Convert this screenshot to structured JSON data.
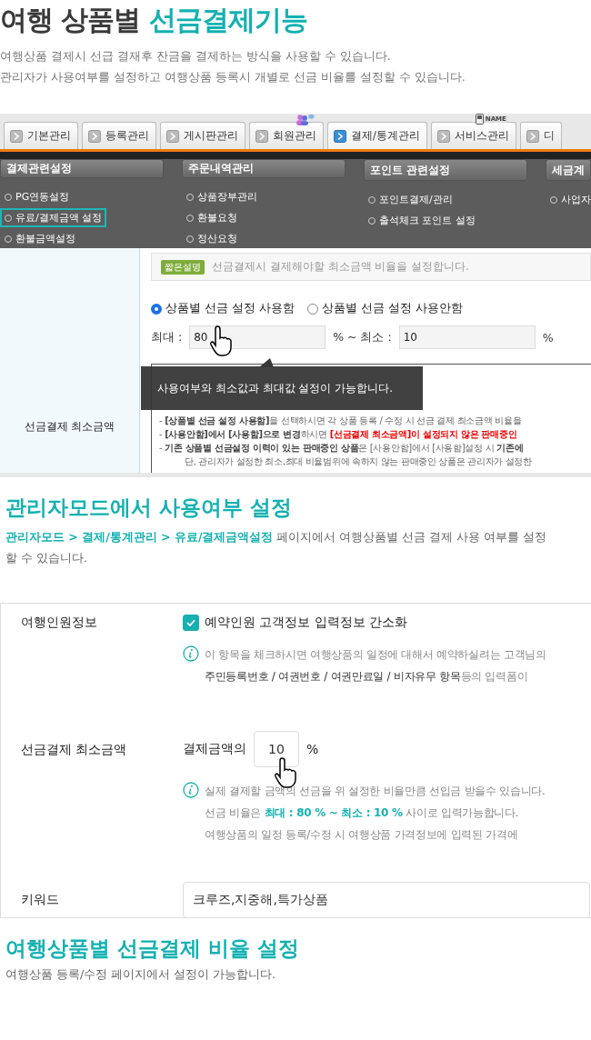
{
  "heading": [
    {
      "text": "여행 상품별 ",
      "kind": "normal"
    },
    {
      "text": "선금결제기능",
      "kind": "highlight"
    }
  ],
  "intro": [
    "여행상품 결제시 선급 결재후 잔금을 결제하는 방식을 사용할 수 있습니다.",
    "관리자가 사용여부를 설정하고 여행상품 등록시 개별로 선금 비율를 설정할 수 있습니다."
  ],
  "admin_screen": {
    "tabs": [
      {
        "label": "기본관리",
        "selected": false
      },
      {
        "label": "등록관리",
        "selected": false
      },
      {
        "label": "게시판관리",
        "selected": false
      },
      {
        "label": "회원관리",
        "selected": false,
        "icon": true
      },
      {
        "label": "결제/통계관리",
        "selected": true
      },
      {
        "label": "서비스관리",
        "selected": false,
        "icon": true,
        "badge": "NAME"
      },
      {
        "label": "디",
        "selected": false
      }
    ],
    "menu": [
      {
        "title": "결제관련설정",
        "items": [
          {
            "label": "PG연동설정",
            "selected": false
          },
          {
            "label": "유료/결제금액 설정",
            "selected": true
          },
          {
            "label": "환불금액설정",
            "selected": false
          }
        ]
      },
      {
        "title": "주문내역관리",
        "items": [
          {
            "label": "상품장부관리",
            "selected": false
          },
          {
            "label": "환불요청",
            "selected": false
          },
          {
            "label": "정산요청",
            "selected": false
          }
        ]
      },
      {
        "title": "포인트 관련설정",
        "items": [
          {
            "label": "포인트결제/관리",
            "selected": false
          },
          {
            "label": "출석체크 포인트 설정",
            "selected": false
          }
        ]
      },
      {
        "title": "세금계",
        "items": [
          {
            "label": "사업자",
            "selected": false
          }
        ]
      }
    ],
    "field_label": "선금결제 최소금액",
    "short_desc": {
      "badge": "짧은설명",
      "text": "선금결제시 결제해야할 최소금액 비율을 설정합니다."
    },
    "radios": [
      {
        "label": "상품별 선금 설정 사용함",
        "selected": true
      },
      {
        "label": "상품별 선금 설정 사용안함",
        "selected": false
      }
    ],
    "range": {
      "max_label": "최대 :",
      "max_value": "80",
      "mid_label": "% ~ 최소 :",
      "min_value": "10",
      "unit": "%"
    },
    "help": {
      "lines": [
        {
          "indent": false,
          "segments": [
            {
              "text": "- ",
              "kind": "normal"
            },
            {
              "text": "[상품별 선금 설정 사용함]",
              "kind": "strong"
            },
            {
              "text": "을 선택하시면 각 상품 등록 / 수정 시 선금 결제 최소금액 비율을",
              "kind": "normal"
            }
          ]
        },
        {
          "indent": false,
          "segments": [
            {
              "text": "- ",
              "kind": "normal"
            },
            {
              "text": "[사용안함]에서 [사용함]으로 변경",
              "kind": "strong"
            },
            {
              "text": "하시면 ",
              "kind": "normal"
            },
            {
              "text": "[선금결제 최소금액]이 설정되지 않은 판매중인",
              "kind": "warning"
            }
          ]
        },
        {
          "indent": false,
          "segments": [
            {
              "text": "- ",
              "kind": "normal"
            },
            {
              "text": "기존 상품별 선금설정 이력이 있는 판매중인 상품",
              "kind": "strong"
            },
            {
              "text": "은 [사용안함]에서 [사용함]설정 시 ",
              "kind": "normal"
            },
            {
              "text": "기존에",
              "kind": "strong"
            }
          ]
        },
        {
          "indent": true,
          "segments": [
            {
              "text": "단, 관리자가 설정한 최소,최대 비율범위에 속하지 않는 판매중인 상품은 관리자가 설정한",
              "kind": "normal"
            }
          ]
        }
      ]
    },
    "tooltip": "사용여부와 최소값과 최대값 설정이 가능합니다."
  },
  "section2": {
    "heading": "관리자모드에서 사용여부 설정",
    "text": [
      {
        "text": "관리자모드 > 결제/통계관리 > 유료/결제금액설정",
        "kind": "highlight"
      },
      {
        "text": " 페이지에서 여행상품별 선금 결제 사용 여부를 설정할 수 있습니다.",
        "kind": "normal"
      }
    ]
  },
  "settings_screen": {
    "traveler_row": {
      "label": "여행인원정보",
      "checkbox": {
        "label": "예약인원 고객정보 입력정보 간소화",
        "checked": true
      },
      "info": [
        [
          {
            "text": "이 항목을 체크하시면 여행상품의 일정에 대해서 예약하실려는 고객님의",
            "kind": "normal"
          }
        ],
        [
          {
            "text": "주민등록번호 / 여권번호 / 여권만료일 / 비자유무 항목",
            "kind": "term"
          },
          {
            "text": "등의 입력폼이",
            "kind": "normal"
          }
        ]
      ]
    },
    "deposit_row": {
      "label": "선금결제 최소금액",
      "prefix": "결제금액의",
      "value": "10",
      "unit": "%",
      "info": [
        [
          {
            "text": "실제 결제할 금액의 선금을 위 설정한 비율만큼 선입금 받을수 있습니다.",
            "kind": "normal"
          }
        ],
        [
          {
            "text": "선금 비율은 ",
            "kind": "normal"
          },
          {
            "text": "최대 : 80 % ~ 최소 : 10 %",
            "kind": "highlight"
          },
          {
            "text": " 사이로 입력가능합니다.",
            "kind": "normal"
          }
        ],
        [
          {
            "text": "여행상품의 일정 등록/수정 시 여행상품 가격정보에 입력된 가격에",
            "kind": "normal"
          }
        ]
      ]
    },
    "keyword_row": {
      "label": "키워드",
      "value": "크루즈,지중해,특가상품"
    }
  },
  "section3": {
    "heading": "여행상품별 선금결제 비율 설정",
    "text": "여행상품 등록/수정 페이지에서 설정이 가능합니다."
  }
}
